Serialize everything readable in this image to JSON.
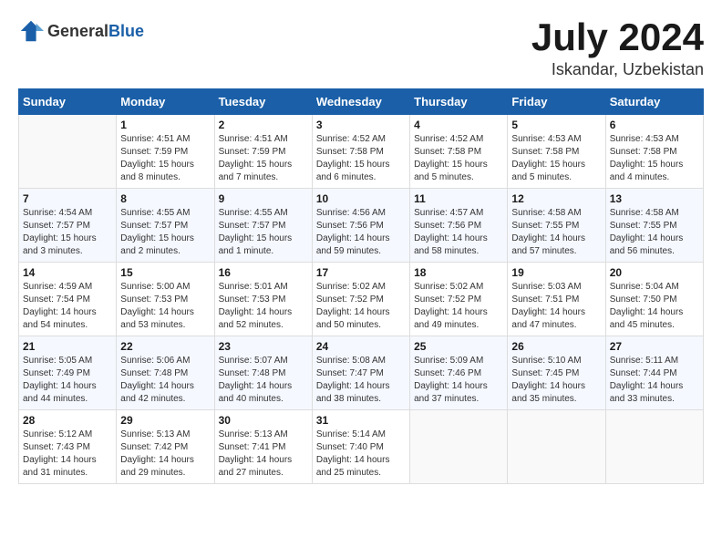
{
  "header": {
    "logo_general": "General",
    "logo_blue": "Blue",
    "month_year": "July 2024",
    "location": "Iskandar, Uzbekistan"
  },
  "weekdays": [
    "Sunday",
    "Monday",
    "Tuesday",
    "Wednesday",
    "Thursday",
    "Friday",
    "Saturday"
  ],
  "weeks": [
    [
      {
        "day": "",
        "sunrise": "",
        "sunset": "",
        "daylight": ""
      },
      {
        "day": "1",
        "sunrise": "Sunrise: 4:51 AM",
        "sunset": "Sunset: 7:59 PM",
        "daylight": "Daylight: 15 hours and 8 minutes."
      },
      {
        "day": "2",
        "sunrise": "Sunrise: 4:51 AM",
        "sunset": "Sunset: 7:59 PM",
        "daylight": "Daylight: 15 hours and 7 minutes."
      },
      {
        "day": "3",
        "sunrise": "Sunrise: 4:52 AM",
        "sunset": "Sunset: 7:58 PM",
        "daylight": "Daylight: 15 hours and 6 minutes."
      },
      {
        "day": "4",
        "sunrise": "Sunrise: 4:52 AM",
        "sunset": "Sunset: 7:58 PM",
        "daylight": "Daylight: 15 hours and 5 minutes."
      },
      {
        "day": "5",
        "sunrise": "Sunrise: 4:53 AM",
        "sunset": "Sunset: 7:58 PM",
        "daylight": "Daylight: 15 hours and 5 minutes."
      },
      {
        "day": "6",
        "sunrise": "Sunrise: 4:53 AM",
        "sunset": "Sunset: 7:58 PM",
        "daylight": "Daylight: 15 hours and 4 minutes."
      }
    ],
    [
      {
        "day": "7",
        "sunrise": "Sunrise: 4:54 AM",
        "sunset": "Sunset: 7:57 PM",
        "daylight": "Daylight: 15 hours and 3 minutes."
      },
      {
        "day": "8",
        "sunrise": "Sunrise: 4:55 AM",
        "sunset": "Sunset: 7:57 PM",
        "daylight": "Daylight: 15 hours and 2 minutes."
      },
      {
        "day": "9",
        "sunrise": "Sunrise: 4:55 AM",
        "sunset": "Sunset: 7:57 PM",
        "daylight": "Daylight: 15 hours and 1 minute."
      },
      {
        "day": "10",
        "sunrise": "Sunrise: 4:56 AM",
        "sunset": "Sunset: 7:56 PM",
        "daylight": "Daylight: 14 hours and 59 minutes."
      },
      {
        "day": "11",
        "sunrise": "Sunrise: 4:57 AM",
        "sunset": "Sunset: 7:56 PM",
        "daylight": "Daylight: 14 hours and 58 minutes."
      },
      {
        "day": "12",
        "sunrise": "Sunrise: 4:58 AM",
        "sunset": "Sunset: 7:55 PM",
        "daylight": "Daylight: 14 hours and 57 minutes."
      },
      {
        "day": "13",
        "sunrise": "Sunrise: 4:58 AM",
        "sunset": "Sunset: 7:55 PM",
        "daylight": "Daylight: 14 hours and 56 minutes."
      }
    ],
    [
      {
        "day": "14",
        "sunrise": "Sunrise: 4:59 AM",
        "sunset": "Sunset: 7:54 PM",
        "daylight": "Daylight: 14 hours and 54 minutes."
      },
      {
        "day": "15",
        "sunrise": "Sunrise: 5:00 AM",
        "sunset": "Sunset: 7:53 PM",
        "daylight": "Daylight: 14 hours and 53 minutes."
      },
      {
        "day": "16",
        "sunrise": "Sunrise: 5:01 AM",
        "sunset": "Sunset: 7:53 PM",
        "daylight": "Daylight: 14 hours and 52 minutes."
      },
      {
        "day": "17",
        "sunrise": "Sunrise: 5:02 AM",
        "sunset": "Sunset: 7:52 PM",
        "daylight": "Daylight: 14 hours and 50 minutes."
      },
      {
        "day": "18",
        "sunrise": "Sunrise: 5:02 AM",
        "sunset": "Sunset: 7:52 PM",
        "daylight": "Daylight: 14 hours and 49 minutes."
      },
      {
        "day": "19",
        "sunrise": "Sunrise: 5:03 AM",
        "sunset": "Sunset: 7:51 PM",
        "daylight": "Daylight: 14 hours and 47 minutes."
      },
      {
        "day": "20",
        "sunrise": "Sunrise: 5:04 AM",
        "sunset": "Sunset: 7:50 PM",
        "daylight": "Daylight: 14 hours and 45 minutes."
      }
    ],
    [
      {
        "day": "21",
        "sunrise": "Sunrise: 5:05 AM",
        "sunset": "Sunset: 7:49 PM",
        "daylight": "Daylight: 14 hours and 44 minutes."
      },
      {
        "day": "22",
        "sunrise": "Sunrise: 5:06 AM",
        "sunset": "Sunset: 7:48 PM",
        "daylight": "Daylight: 14 hours and 42 minutes."
      },
      {
        "day": "23",
        "sunrise": "Sunrise: 5:07 AM",
        "sunset": "Sunset: 7:48 PM",
        "daylight": "Daylight: 14 hours and 40 minutes."
      },
      {
        "day": "24",
        "sunrise": "Sunrise: 5:08 AM",
        "sunset": "Sunset: 7:47 PM",
        "daylight": "Daylight: 14 hours and 38 minutes."
      },
      {
        "day": "25",
        "sunrise": "Sunrise: 5:09 AM",
        "sunset": "Sunset: 7:46 PM",
        "daylight": "Daylight: 14 hours and 37 minutes."
      },
      {
        "day": "26",
        "sunrise": "Sunrise: 5:10 AM",
        "sunset": "Sunset: 7:45 PM",
        "daylight": "Daylight: 14 hours and 35 minutes."
      },
      {
        "day": "27",
        "sunrise": "Sunrise: 5:11 AM",
        "sunset": "Sunset: 7:44 PM",
        "daylight": "Daylight: 14 hours and 33 minutes."
      }
    ],
    [
      {
        "day": "28",
        "sunrise": "Sunrise: 5:12 AM",
        "sunset": "Sunset: 7:43 PM",
        "daylight": "Daylight: 14 hours and 31 minutes."
      },
      {
        "day": "29",
        "sunrise": "Sunrise: 5:13 AM",
        "sunset": "Sunset: 7:42 PM",
        "daylight": "Daylight: 14 hours and 29 minutes."
      },
      {
        "day": "30",
        "sunrise": "Sunrise: 5:13 AM",
        "sunset": "Sunset: 7:41 PM",
        "daylight": "Daylight: 14 hours and 27 minutes."
      },
      {
        "day": "31",
        "sunrise": "Sunrise: 5:14 AM",
        "sunset": "Sunset: 7:40 PM",
        "daylight": "Daylight: 14 hours and 25 minutes."
      },
      {
        "day": "",
        "sunrise": "",
        "sunset": "",
        "daylight": ""
      },
      {
        "day": "",
        "sunrise": "",
        "sunset": "",
        "daylight": ""
      },
      {
        "day": "",
        "sunrise": "",
        "sunset": "",
        "daylight": ""
      }
    ]
  ]
}
